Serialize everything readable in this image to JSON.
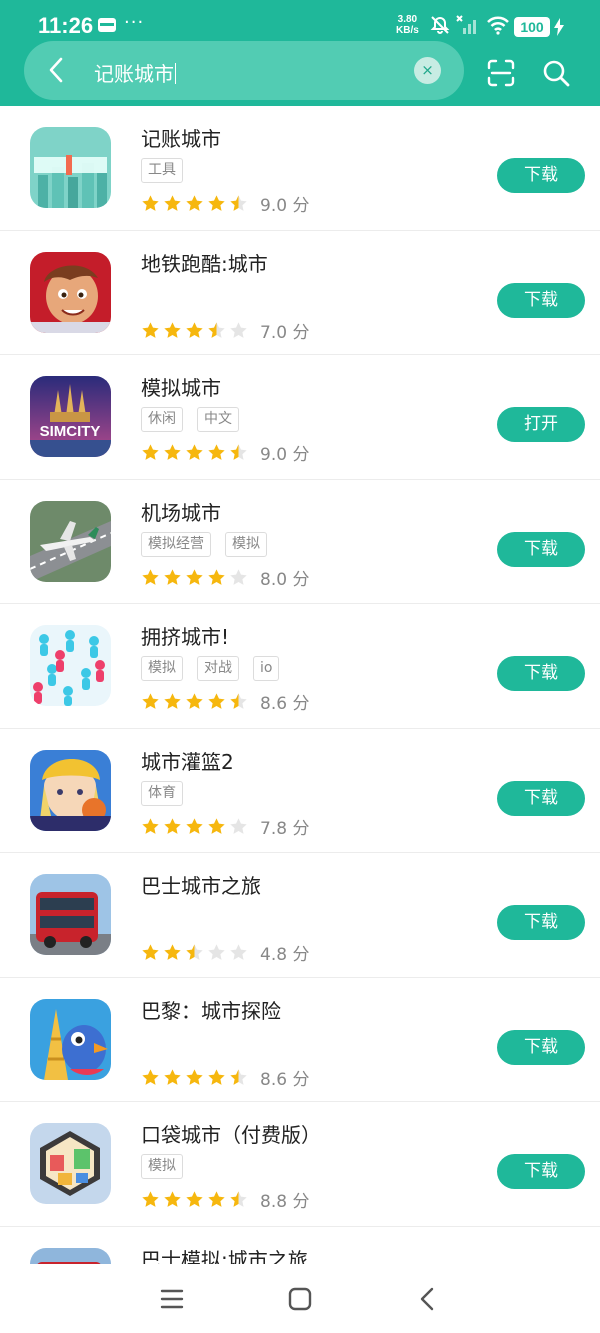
{
  "status_bar": {
    "time": "11:26",
    "dots": "···",
    "net_speed_value": "3.80",
    "net_speed_unit": "KB/s",
    "battery": "100"
  },
  "search": {
    "query": "记账城市",
    "clear_label": "×"
  },
  "colors": {
    "accent": "#1fb89a",
    "star_full": "#f6b70e",
    "star_empty": "#e5e5e5"
  },
  "apps": [
    {
      "name": "记账城市",
      "tags": [
        "工具"
      ],
      "score": "9.0 分",
      "rating": 4.5,
      "button": "下载",
      "icon": "fortune-city-icon"
    },
    {
      "name": "地铁跑酷:城市",
      "tags": [],
      "score": "7.0 分",
      "rating": 3.5,
      "button": "下载",
      "icon": "subway-surfers-icon"
    },
    {
      "name": "模拟城市",
      "tags": [
        "休闲",
        "中文"
      ],
      "score": "9.0 分",
      "rating": 4.5,
      "button": "打开",
      "icon": "simcity-icon",
      "icon_text": "SIMCITY"
    },
    {
      "name": "机场城市",
      "tags": [
        "模拟经营",
        "模拟"
      ],
      "score": "8.0 分",
      "rating": 4,
      "button": "下载",
      "icon": "airport-city-icon"
    },
    {
      "name": "拥挤城市!",
      "tags": [
        "模拟",
        "对战",
        "io"
      ],
      "score": "8.6 分",
      "rating": 4.5,
      "button": "下载",
      "icon": "crowd-city-icon"
    },
    {
      "name": "城市灌篮2",
      "tags": [
        "体育"
      ],
      "score": "7.8 分",
      "rating": 4,
      "button": "下载",
      "icon": "city-dunk-icon"
    },
    {
      "name": "巴士城市之旅",
      "tags": [],
      "score": "4.8 分",
      "rating": 2.5,
      "button": "下载",
      "icon": "bus-city-icon"
    },
    {
      "name": "巴黎：城市探险",
      "tags": [],
      "score": "8.6 分",
      "rating": 4.5,
      "button": "下载",
      "icon": "paris-adventure-icon"
    },
    {
      "name": "口袋城市（付费版）",
      "tags": [
        "模拟"
      ],
      "score": "8.8 分",
      "rating": 4.5,
      "button": "下载",
      "icon": "pocket-city-icon"
    },
    {
      "name": "巴士模拟:城市之旅",
      "tags": [],
      "score": "",
      "rating": 0,
      "button": "",
      "icon": "bus-sim-icon",
      "partial": true
    }
  ]
}
